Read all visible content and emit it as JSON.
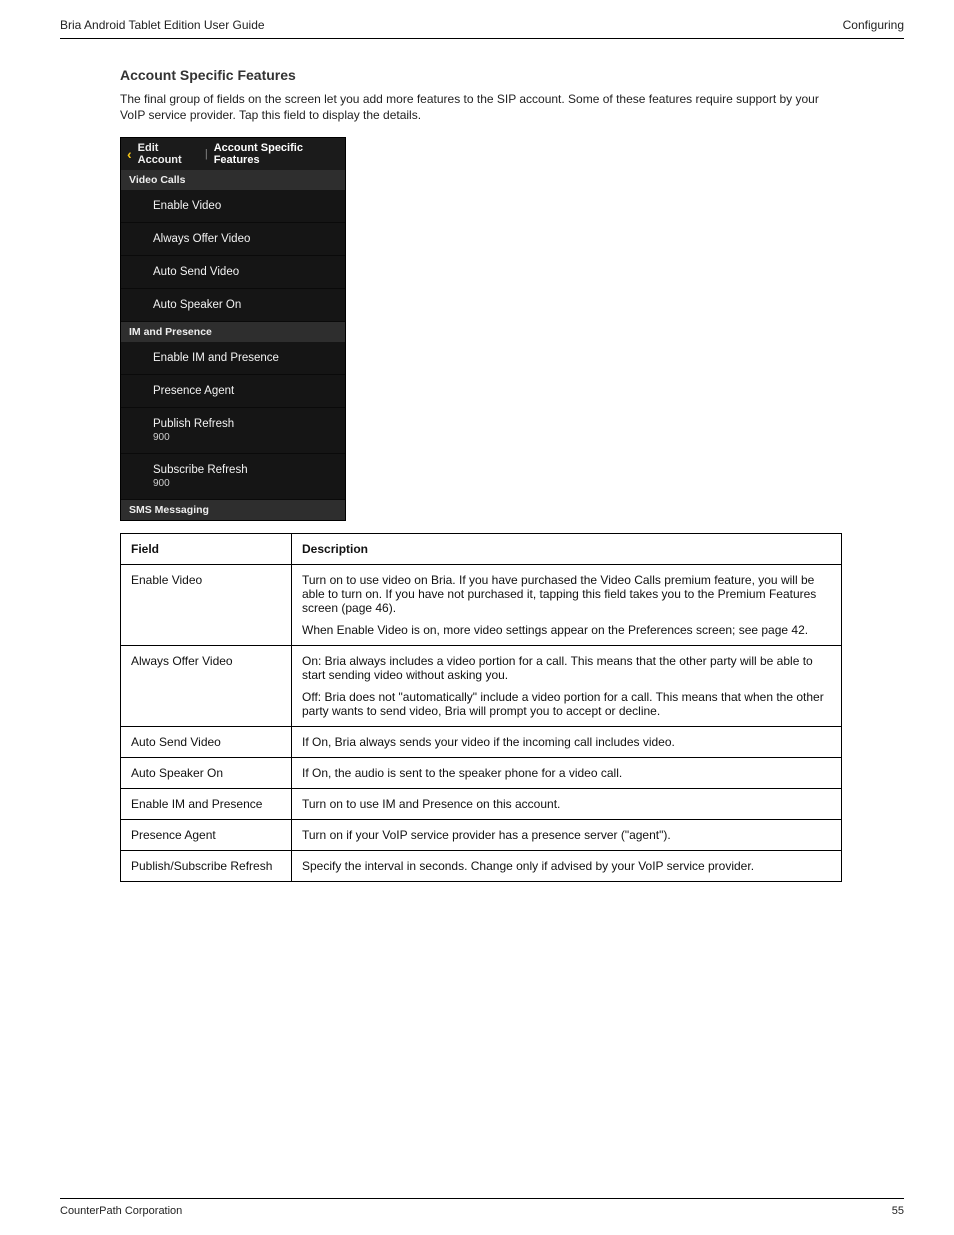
{
  "header": {
    "left": "Bria Android Tablet Edition User Guide",
    "right": "Configuring"
  },
  "section": {
    "heading": "Account Specific Features",
    "intro": "The final group of fields on the screen let you add more features to the SIP account. Some of these features require support by your VoIP service provider. Tap this field to display the details."
  },
  "shot": {
    "back_title": "Edit Account",
    "main_title": "Account Specific Features",
    "groups": [
      {
        "name": "Video Calls",
        "rows": [
          {
            "label": "Enable Video"
          },
          {
            "label": "Always Offer Video"
          },
          {
            "label": "Auto Send Video"
          },
          {
            "label": "Auto Speaker On"
          }
        ]
      },
      {
        "name": "IM and Presence",
        "rows": [
          {
            "label": "Enable IM and Presence"
          },
          {
            "label": "Presence Agent"
          },
          {
            "label": "Publish Refresh",
            "sub": "900"
          },
          {
            "label": "Subscribe Refresh",
            "sub": "900"
          }
        ]
      },
      {
        "name": "SMS Messaging",
        "rows": []
      }
    ]
  },
  "table": {
    "head": {
      "field": "Field",
      "desc": "Description"
    },
    "rows": [
      {
        "field": "Enable Video",
        "desc": [
          "Turn on to use video on Bria. If you have purchased the Video Calls premium feature, you will be able to turn on. If you have not purchased it, tapping this field takes you to the Premium Features screen (page 46).",
          "When Enable Video is on, more video settings appear on the Preferences screen; see page 42."
        ]
      },
      {
        "field": "Always Offer Video",
        "desc": [
          "On: Bria always includes a video portion for a call. This means that the other party will be able to start sending video without asking you.",
          "Off: Bria does not \"automatically\" include a video portion for a call. This means that when the other party wants to send video, Bria will prompt you to accept or decline."
        ]
      },
      {
        "field": "Auto Send Video",
        "desc": [
          "If On, Bria always sends your video if the incoming call includes video."
        ]
      },
      {
        "field": "Auto Speaker On",
        "desc": [
          "If On, the audio is sent to the speaker phone for a video call."
        ]
      },
      {
        "field": "Enable IM and Presence",
        "desc": [
          "Turn on to use IM and Presence on this account."
        ]
      },
      {
        "field": "Presence Agent",
        "desc": [
          "Turn on if your VoIP service provider has a presence server (\"agent\")."
        ]
      },
      {
        "field": "Publish/Subscribe Refresh",
        "desc": [
          "Specify the interval in seconds. Change only if advised by your VoIP service provider."
        ]
      }
    ]
  },
  "footer": {
    "left": "CounterPath Corporation",
    "right": "55"
  }
}
